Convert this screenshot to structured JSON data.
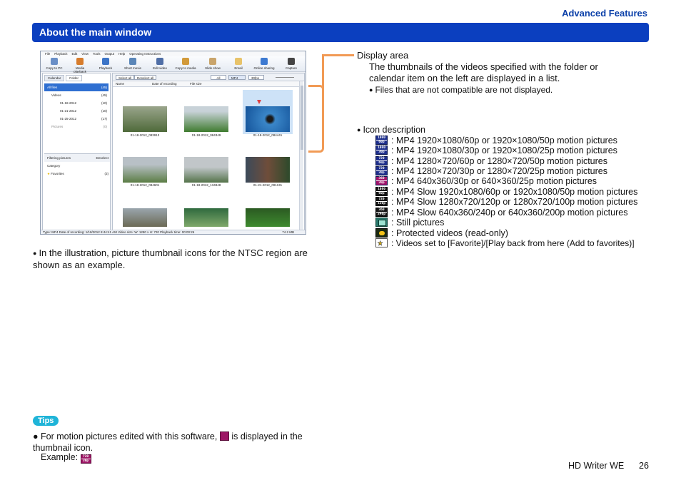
{
  "header": {
    "section": "Advanced Features",
    "title": "About the main window"
  },
  "app": {
    "menu": [
      "File",
      "Playback",
      "Edit",
      "View",
      "Tools",
      "Output",
      "Help",
      "Operating Instructions"
    ],
    "toolbar": [
      "Copy to PC",
      "Media playback",
      "Playback",
      "Short movie",
      "Edit video",
      "Copy to media",
      "Slide show",
      "Email",
      "Online sharing",
      "Capture"
    ],
    "tabs": [
      "Calendar",
      "Folder"
    ],
    "tree": [
      {
        "label": "All files",
        "count": "(45)"
      },
      {
        "label": "Videos",
        "count": "(45)"
      },
      {
        "label": "01-18-2012",
        "count": "(10)"
      },
      {
        "label": "01-21-2012",
        "count": "(10)"
      },
      {
        "label": "01-25-2012",
        "count": "(17)"
      },
      {
        "label": "Pictures",
        "count": "(0)"
      }
    ],
    "filter_header": "Filtering pictures",
    "filter_clear": "Deselect",
    "filter_tab": "Category",
    "filter_item": {
      "label": "Favorites",
      "count": "(3)"
    },
    "select_all": "Select all",
    "deselect_all": "Deselect all",
    "filter_all": "All",
    "filter_format": "MP4",
    "filter_rate": "30fps",
    "columns": [
      "Name",
      "Date of recording",
      "File size"
    ],
    "thumbs": [
      "01-18-2012_083913",
      "01-18-2012_084349",
      "01-18-2012_084441",
      "01-18-2012_084601",
      "01-18-2012_134848",
      "01-21-2012_091131"
    ],
    "status_left": "Type: MP4  Date of recording: 1/18/2012 8:44:41 AM  Video size: W: 1280 x H: 720 Playback time: 00:00:26",
    "status_right": "74.2 MB"
  },
  "display_area": {
    "title": "Display area",
    "desc": "The thumbnails of the videos specified with the folder or calendar item on the left are displayed in a list.",
    "note": "Files that are not compatible are not displayed."
  },
  "icons": {
    "title": "Icon description",
    "items": [
      {
        "icon": "mp4-60p-icon",
        "top": "1080",
        "bottom": "60p",
        "text": ": MP4 1920×1080/60p or 1920×1080/50p motion pictures"
      },
      {
        "icon": "mp4-30p-icon",
        "top": "1080",
        "bottom": "30p",
        "text": ": MP4 1920×1080/30p or 1920×1080/25p motion pictures"
      },
      {
        "icon": "mp4-720-60p-icon",
        "top": "720",
        "bottom": "60p",
        "text": ": MP4 1280×720/60p or 1280×720/50p motion pictures"
      },
      {
        "icon": "mp4-720-30p-icon",
        "top": "720",
        "bottom": "30p",
        "text": ": MP4 1280×720/30p or 1280×720/25p motion pictures"
      },
      {
        "icon": "mp4-360-30p-icon",
        "top": "360",
        "bottom": "30p",
        "text": ": MP4 640x360/30p or 640×360/25p motion pictures"
      },
      {
        "icon": "slow-1080-icon",
        "top": "1080",
        "bottom": "60p",
        "text": ": MP4 Slow 1920x1080/60p or 1920x1080/50p motion pictures"
      },
      {
        "icon": "slow-720-icon",
        "top": "720",
        "bottom": "120p",
        "text": ": MP4 Slow 1280x720/120p or 1280x720/100p motion pictures"
      },
      {
        "icon": "slow-360-icon",
        "top": "360",
        "bottom": "240p",
        "text": ": MP4 Slow 640x360/240p or 640x360/200p motion pictures"
      },
      {
        "icon": "still-picture-icon",
        "top": "",
        "bottom": "",
        "text": ": Still pictures"
      },
      {
        "icon": "protected-icon",
        "top": "",
        "bottom": "",
        "text": ": Protected videos (read-only)"
      },
      {
        "icon": "favorite-icon",
        "top": "",
        "bottom": "",
        "text": ": Videos set to [Favorite]/[Play back from here (Add to favorites)]"
      }
    ]
  },
  "illustration_note": "In the illustration, picture thumbnail icons for the NTSC region are shown as an example.",
  "tips": {
    "label": "Tips",
    "text_a": "For motion pictures edited with this software,",
    "text_b": "is displayed in the thumbnail icon.",
    "example_label": "Example:",
    "example_top": "720",
    "example_bottom": "30p"
  },
  "footer": {
    "product": "HD Writer WE",
    "page": "26"
  }
}
